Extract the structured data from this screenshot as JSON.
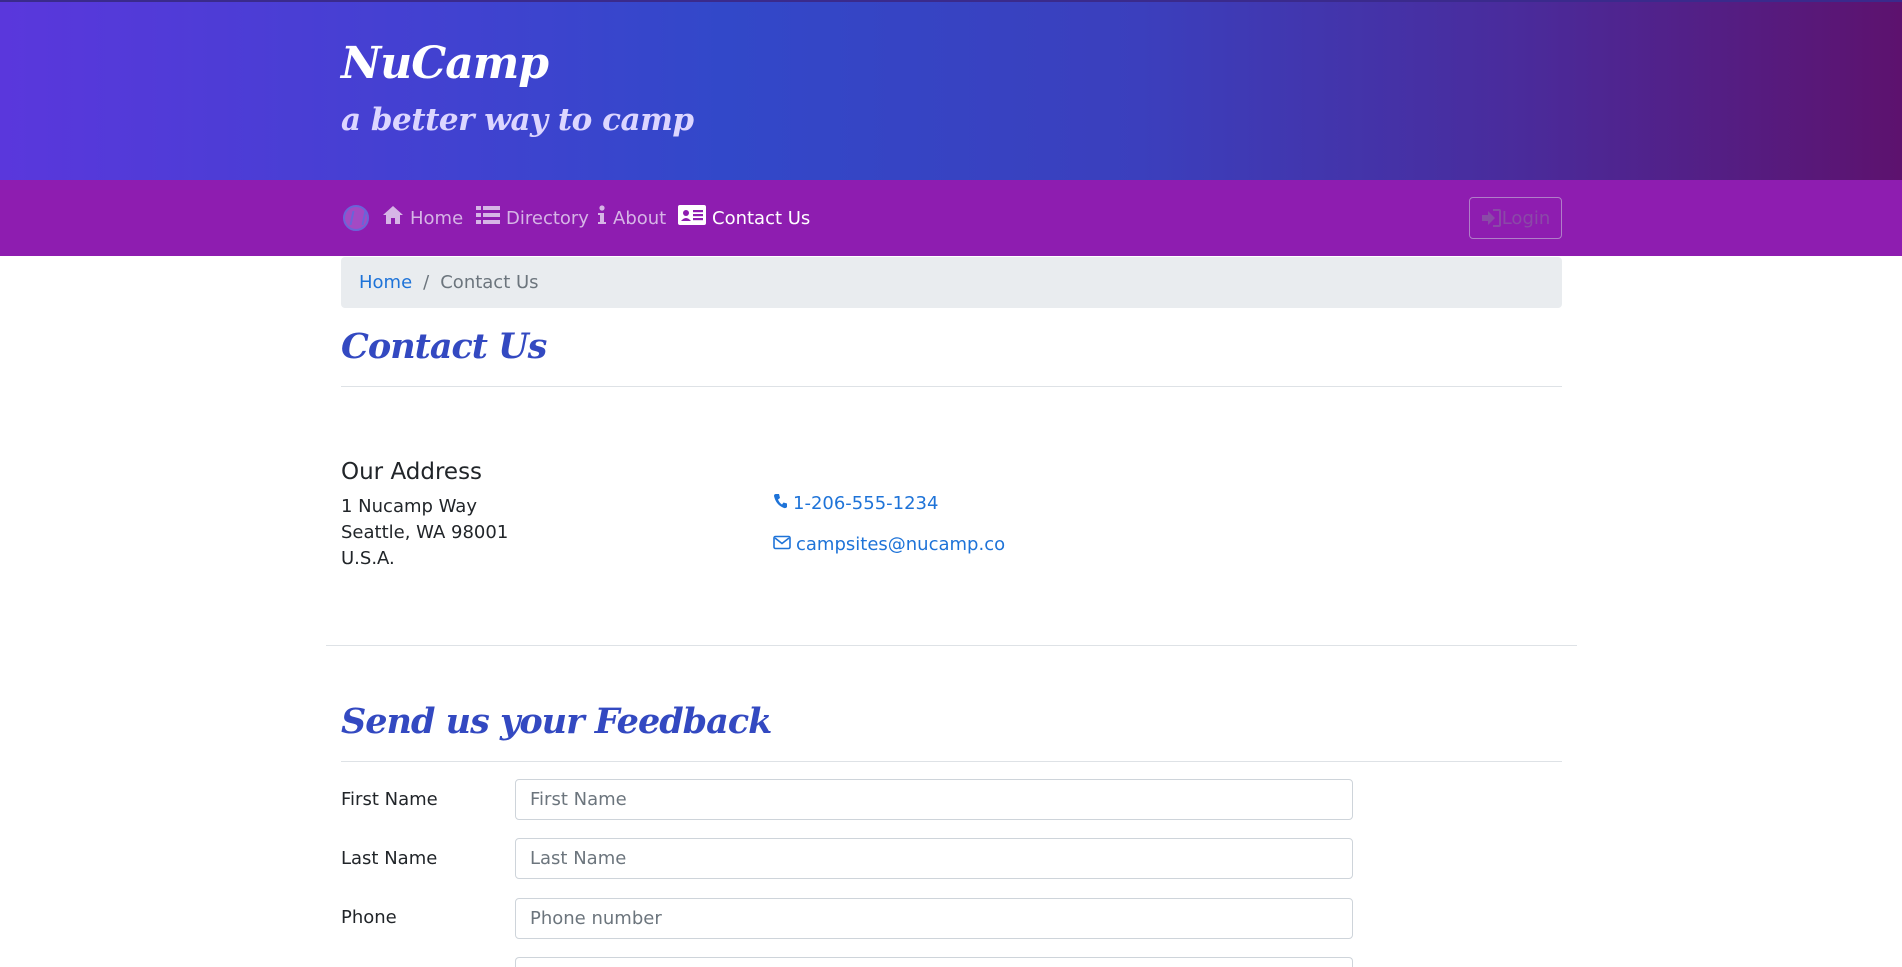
{
  "header": {
    "title": "NuCamp",
    "subtitle": "a better way to camp"
  },
  "nav": {
    "logo_icon": "nucamp-logo-icon",
    "items": [
      {
        "label": "Home",
        "icon": "home-icon"
      },
      {
        "label": "Directory",
        "icon": "list-icon"
      },
      {
        "label": "About",
        "icon": "info-icon"
      },
      {
        "label": "Contact Us",
        "icon": "address-card-icon",
        "active": true
      }
    ],
    "login_label": "Login",
    "login_icon": "sign-in-icon"
  },
  "breadcrumb": {
    "home": "Home",
    "separator": "/",
    "current": "Contact Us"
  },
  "contact": {
    "title": "Contact Us",
    "address_heading": "Our Address",
    "address_lines": [
      "1 Nucamp Way",
      "Seattle, WA 98001",
      "U.S.A."
    ],
    "phone": "1-206-555-1234",
    "phone_icon": "phone-icon",
    "email": "campsites@nucamp.co",
    "email_icon": "envelope-icon"
  },
  "feedback": {
    "title": "Send us your Feedback",
    "fields": [
      {
        "label": "First Name",
        "placeholder": "First Name",
        "value": ""
      },
      {
        "label": "Last Name",
        "placeholder": "Last Name",
        "value": ""
      },
      {
        "label": "Phone",
        "placeholder": "Phone number",
        "value": ""
      }
    ]
  },
  "colors": {
    "header_gradient_start": "#5a37dc",
    "header_gradient_end": "#5d126e",
    "navbar": "#8e1db0",
    "heading": "#3349c1",
    "link": "#1e73d8"
  }
}
